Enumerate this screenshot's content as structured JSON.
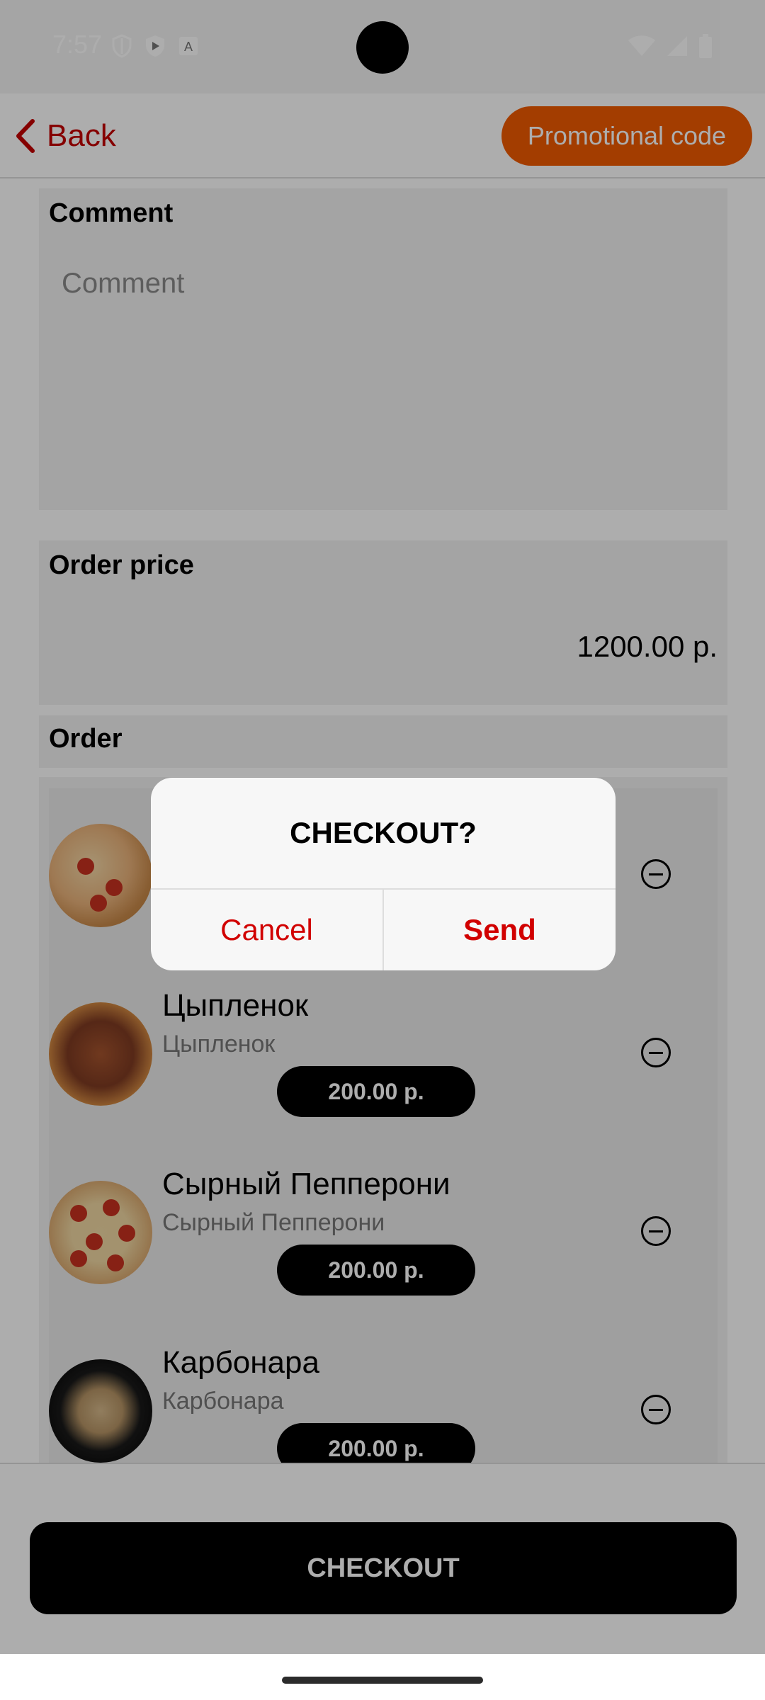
{
  "status_bar": {
    "time": "7:57",
    "left_icons": [
      "shield-icon",
      "play-protect-icon",
      "text-icon"
    ],
    "right_icons": [
      "wifi-icon",
      "signal-icon",
      "battery-icon"
    ]
  },
  "topbar": {
    "back_label": "Back",
    "promo_label": "Promotional code"
  },
  "comment": {
    "title": "Comment",
    "placeholder": "Comment"
  },
  "order_price": {
    "title": "Order price",
    "value": "1200.00 р."
  },
  "order": {
    "title": "Order",
    "items": [
      {
        "name": "",
        "subtitle": "",
        "price": "",
        "thumb": "pizza-image"
      },
      {
        "name": "Цыпленок",
        "subtitle": "Цыпленок",
        "price": "200.00 р.",
        "thumb": "pizza-image"
      },
      {
        "name": "Сырный Пепперони",
        "subtitle": "Сырный Пепперони",
        "price": "200.00 р.",
        "thumb": "pizza-image"
      },
      {
        "name": "Карбонара",
        "subtitle": "Карбонара",
        "price": "200.00 р.",
        "thumb": "pasta-image"
      }
    ]
  },
  "checkout_label": "CHECKOUT",
  "dialog": {
    "title": "CHECKOUT?",
    "cancel_label": "Cancel",
    "send_label": "Send"
  },
  "colors": {
    "accent_red": "#c40000",
    "promo_orange": "#f05a00",
    "button_black": "#000000"
  }
}
